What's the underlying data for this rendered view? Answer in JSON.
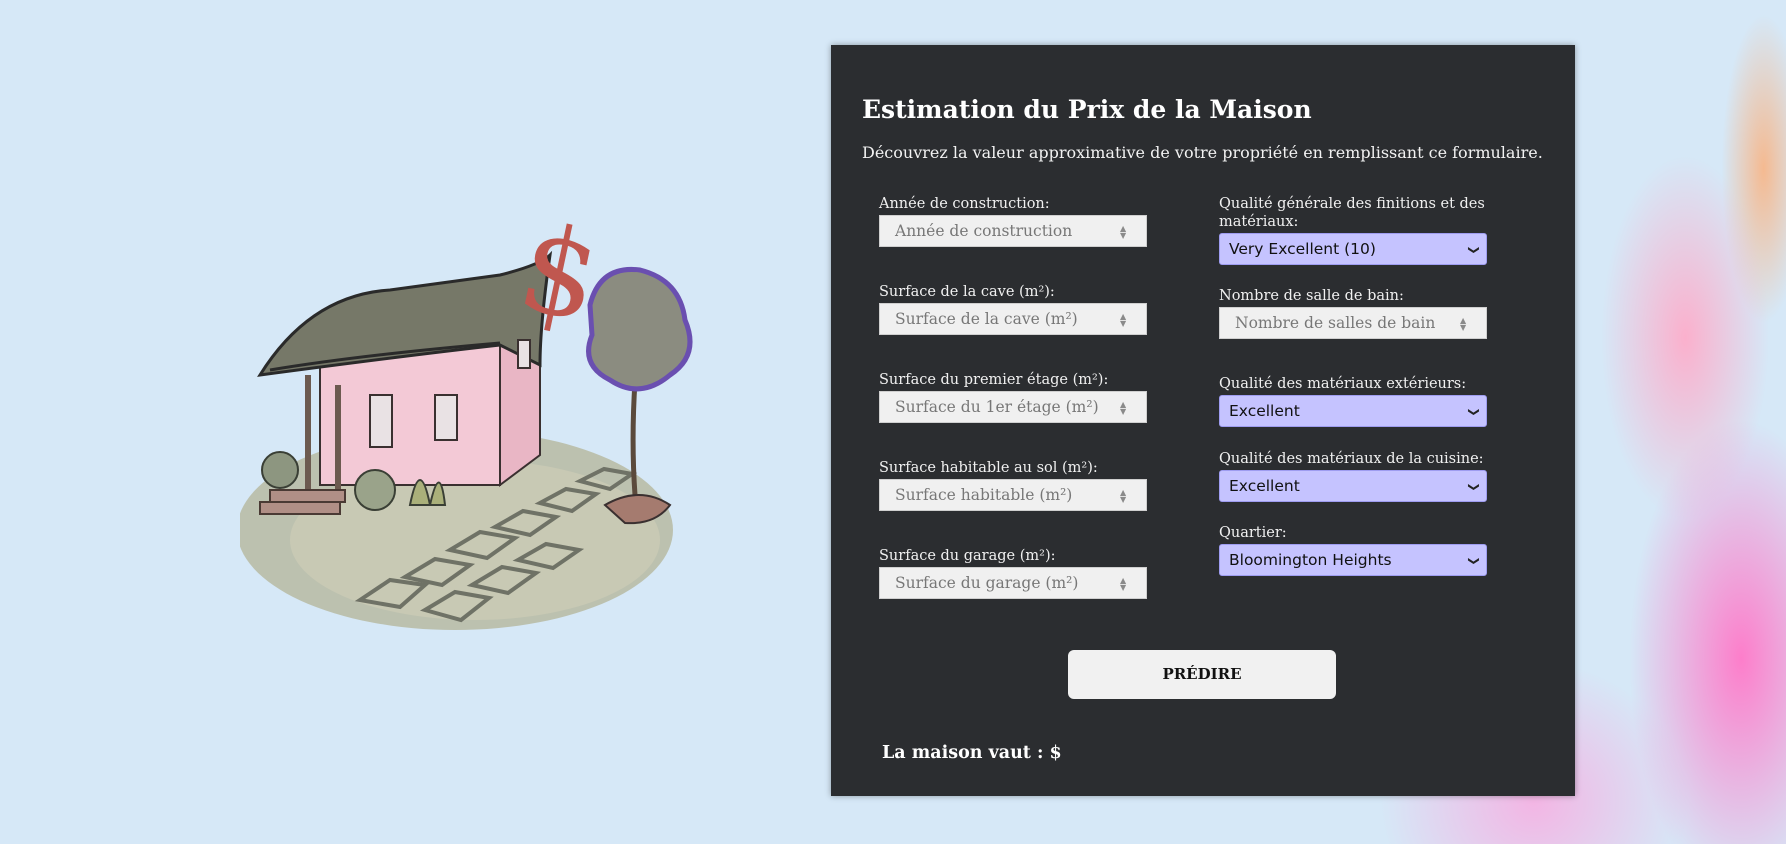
{
  "page": {
    "title": "Estimation du Prix de la Maison",
    "subtitle": "Découvrez la valeur approximative de votre propriété en remplissant ce formulaire."
  },
  "left_fields": [
    {
      "label": "Année de construction:",
      "placeholder": "Année de construction"
    },
    {
      "label": "Surface de la cave (m²):",
      "placeholder": "Surface de la cave (m²)"
    },
    {
      "label": "Surface du premier étage (m²):",
      "placeholder": "Surface du 1er étage (m²)"
    },
    {
      "label": "Surface habitable au sol (m²):",
      "placeholder": "Surface habitable (m²)"
    },
    {
      "label": "Surface du garage (m²):",
      "placeholder": "Surface du garage (m²)"
    }
  ],
  "right_fields": {
    "overall_quality": {
      "label": "Qualité générale des finitions et des matériaux:",
      "value": "Very Excellent (10)"
    },
    "bathrooms": {
      "label": "Nombre de salle de bain:",
      "placeholder": "Nombre de salles de bain"
    },
    "exterior_quality": {
      "label": "Qualité des matériaux extérieurs:",
      "value": "Excellent"
    },
    "kitchen_quality": {
      "label": "Qualité des matériaux de la cuisine:",
      "value": "Excellent"
    },
    "neighborhood": {
      "label": "Quartier:",
      "value": "Bloomington Heights"
    }
  },
  "predict_button": "PRÉDIRE",
  "result_text": "La maison vaut : $",
  "icons": {
    "spinner": "spinner-arrows-icon",
    "dropdown": "chevron-down-icon"
  },
  "colors": {
    "card": "#2b2d30",
    "select_bg": "#c5c3ff",
    "input_bg": "#f0f0f0",
    "page_bg": "#d6e8f7"
  }
}
